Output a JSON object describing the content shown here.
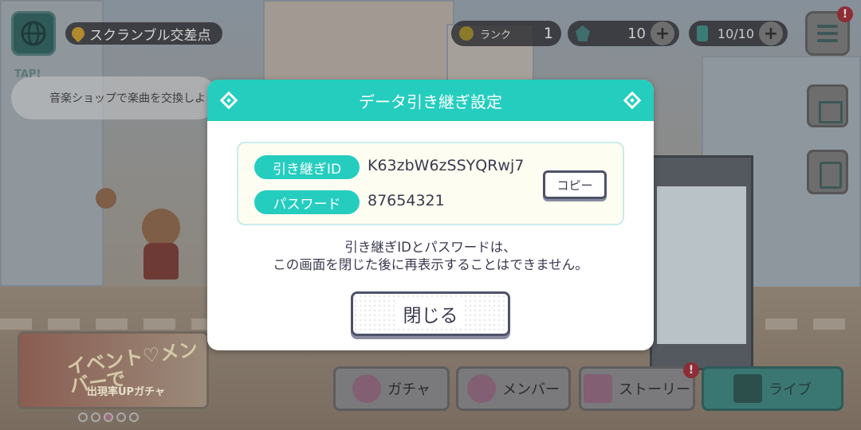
{
  "hud": {
    "location": "スクランブル交差点",
    "rank_label": "ランク",
    "rank_value": "1",
    "crystals": "10",
    "energy": "10/10",
    "plus": "+",
    "menu_alert": "!"
  },
  "hint": {
    "tap_label": "TAP!",
    "text": "音楽ショップで楽曲を交換しよ"
  },
  "banner": {
    "title": "イベント♡メンバーで",
    "subtitle": "出現率UPガチャ"
  },
  "nav": {
    "gacha": "ガチャ",
    "member": "メンバー",
    "story": "ストーリー",
    "live": "ライブ",
    "story_alert": "!"
  },
  "dialog": {
    "title": "データ引き継ぎ設定",
    "id_label": "引き継ぎID",
    "id_value": "K63zbW6zSSYQRwj7",
    "password_label": "パスワード",
    "password_value": "87654321",
    "copy_label": "コピー",
    "notice_line1": "引き継ぎIDとパスワードは、",
    "notice_line2": "この画面を閉じた後に再表示することはできません。",
    "close_label": "閉じる"
  },
  "colors": {
    "accent": "#25cdbf",
    "text": "#3a3a50",
    "info_bg": "#fdfdf1"
  }
}
